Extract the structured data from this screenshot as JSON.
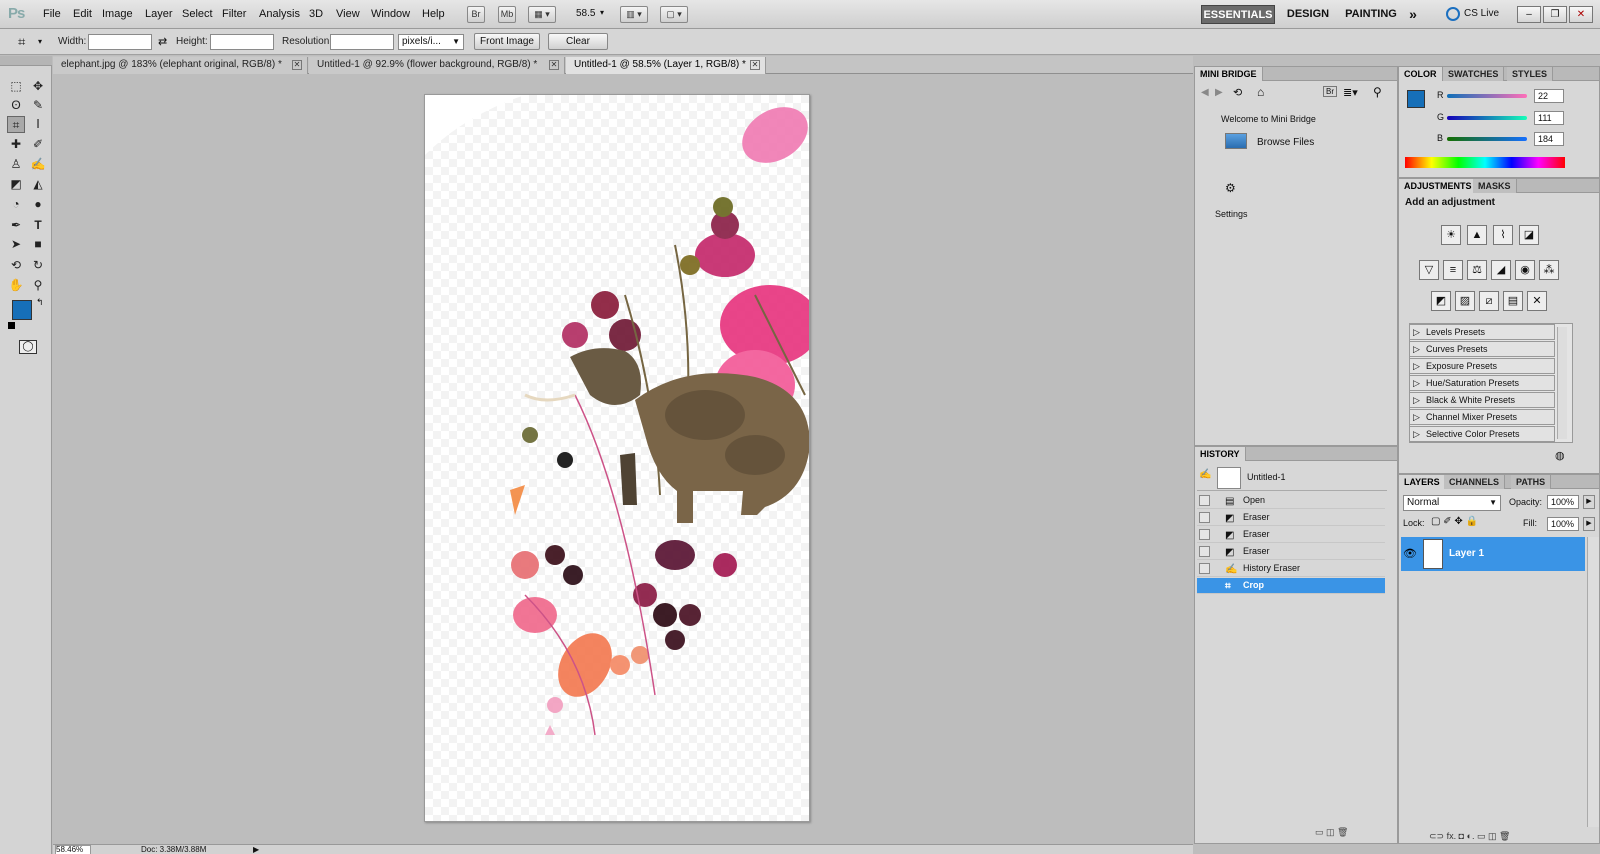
{
  "menubar": {
    "logo": "Ps",
    "items": [
      "File",
      "Edit",
      "Image",
      "Layer",
      "Select",
      "Filter",
      "Analysis",
      "3D",
      "View",
      "Window",
      "Help"
    ],
    "bridge_btn": "Br",
    "minibridge_btn": "Mb",
    "zoom_value": "58.5",
    "workspaces": [
      "ESSENTIALS",
      "DESIGN",
      "PAINTING"
    ],
    "more": "»",
    "cs_live": "CS Live",
    "window_controls": [
      "–",
      "❐",
      "✕"
    ]
  },
  "options": {
    "width_label": "Width:",
    "height_label": "Height:",
    "resolution_label": "Resolution:",
    "units_value": "pixels/i...",
    "front_image": "Front Image",
    "clear": "Clear"
  },
  "tabs": [
    {
      "label": "elephant.jpg @ 183% (elephant original, RGB/8) *"
    },
    {
      "label": "Untitled-1 @ 92.9% (flower background, RGB/8) *"
    },
    {
      "label": "Untitled-1 @ 58.5% (Layer 1, RGB/8) *"
    }
  ],
  "status": {
    "zoom": "58.46%",
    "doc": "Doc: 3.38M/3.88M"
  },
  "mini_bridge": {
    "tab": "MINI BRIDGE",
    "welcome": "Welcome to Mini Bridge",
    "browse": "Browse Files",
    "settings": "Settings"
  },
  "color_panel": {
    "tabs": [
      "COLOR",
      "SWATCHES",
      "STYLES"
    ],
    "r_label": "R",
    "g_label": "G",
    "b_label": "B",
    "r": "22",
    "g": "111",
    "b": "184",
    "foreground": "#166fb8"
  },
  "adjustments": {
    "tabs": [
      "ADJUSTMENTS",
      "MASKS"
    ],
    "heading": "Add an adjustment",
    "presets": [
      "Levels Presets",
      "Curves Presets",
      "Exposure Presets",
      "Hue/Saturation Presets",
      "Black & White Presets",
      "Channel Mixer Presets",
      "Selective Color Presets"
    ]
  },
  "history": {
    "tab": "HISTORY",
    "snapshot": "Untitled-1",
    "steps": [
      "Open",
      "Eraser",
      "Eraser",
      "Eraser",
      "History Eraser",
      "Crop"
    ],
    "selected": "Crop"
  },
  "layers": {
    "tabs": [
      "LAYERS",
      "CHANNELS",
      "PATHS"
    ],
    "blend_mode": "Normal",
    "opacity_label": "Opacity:",
    "opacity": "100%",
    "lock_label": "Lock:",
    "fill_label": "Fill:",
    "fill": "100%",
    "layer_name": "Layer 1",
    "bottom_icons": "⊂⊃  fx.  ◘  ◐.  ▭  ◫  🗑"
  },
  "colors": {
    "accent": "#3a94e6",
    "foreground_swatch": "#166fb8"
  }
}
